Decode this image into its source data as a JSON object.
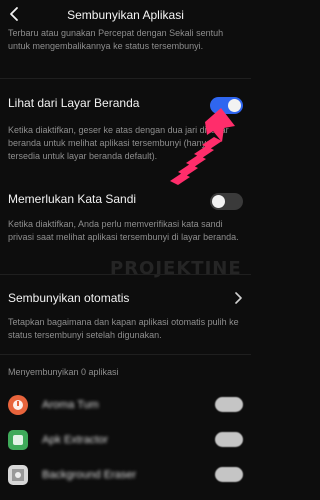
{
  "header": {
    "title": "Sembunyikan Aplikasi"
  },
  "intro": {
    "text": "Terbaru atau gunakan Percepat dengan Sekali sentuh untuk mengembalikannya ke status tersembunyi."
  },
  "home_screen": {
    "title": "Lihat dari Layar Beranda",
    "enabled": true,
    "description": "Ketika diaktifkan, geser ke atas dengan dua jari di layar beranda untuk melihat aplikasi tersembunyi (hanya tersedia untuk layar beranda default)."
  },
  "password": {
    "title": "Memerlukan Kata Sandi",
    "enabled": false,
    "description": "Ketika diaktifkan, Anda perlu memverifikasi kata sandi privasi saat melihat aplikasi tersembunyi di layar beranda."
  },
  "auto_hide": {
    "title": "Sembunyikan otomatis",
    "description": "Tetapkan bagaimana dan kapan aplikasi otomatis pulih ke status tersembunyi setelah digunakan."
  },
  "apps_section": {
    "header": "Menyembunyikan 0 aplikasi"
  },
  "apps": [
    {
      "name": "Aroma Tum",
      "icon": "orange-app-icon",
      "color": "#e8643c",
      "enabled": true
    },
    {
      "name": "Apk Extractor",
      "icon": "green-app-icon",
      "color": "#3faa5a",
      "enabled": true
    },
    {
      "name": "Background Eraser",
      "icon": "photo-app-icon",
      "color": "#d8d8d8",
      "enabled": true
    }
  ],
  "watermark": "PROJEKTINE",
  "colors": {
    "accent": "#2f66f0",
    "arrow": "#ff2d6b",
    "background": "#0d0d0d"
  }
}
